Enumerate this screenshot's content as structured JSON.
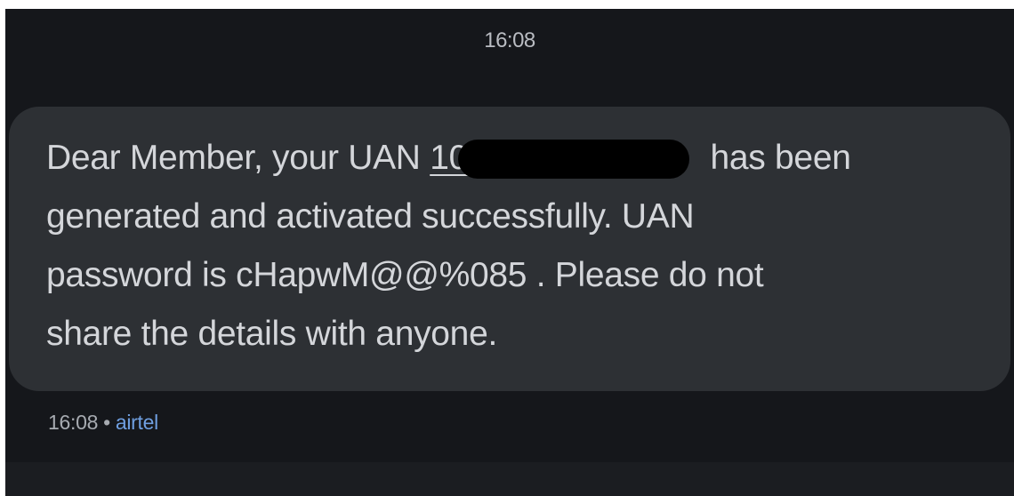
{
  "header": {
    "time": "16:08"
  },
  "message": {
    "line1_before": "Dear Member, your UAN ",
    "uan_visible": "10",
    "line1_after": " has been",
    "line2": "generated and activated successfully. UAN",
    "line3": "password is cHapwM@@%085 . Please do not",
    "line4": "share the details with anyone.",
    "timestamp": "16:08",
    "separator": "•",
    "sender": "airtel"
  },
  "colors": {
    "background": "#15171b",
    "bubble": "#2d3034",
    "text": "#d4d6da",
    "sender_link": "#6f9fe0",
    "redaction": "#000000"
  }
}
